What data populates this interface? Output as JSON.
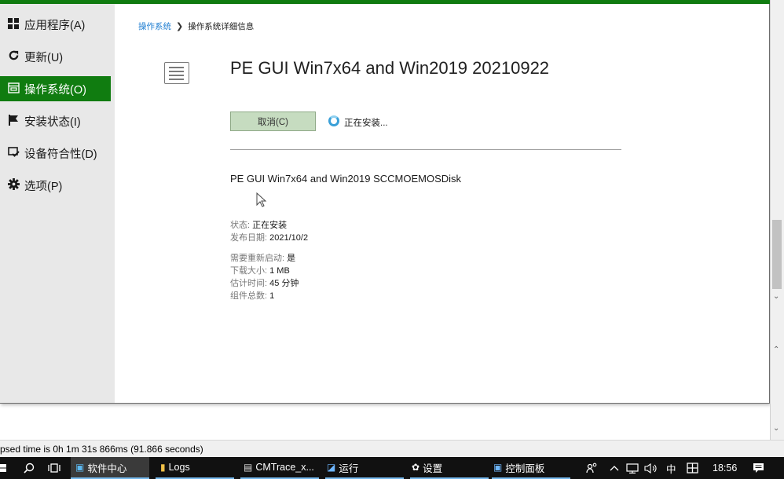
{
  "sidebar": {
    "items": [
      {
        "icon": "apps-grid-icon",
        "glyph": "▦",
        "label": "应用程序(A)"
      },
      {
        "icon": "refresh-icon",
        "glyph": "↻",
        "label": "更新(U)"
      },
      {
        "icon": "os-window-icon",
        "glyph": "⧉",
        "label": "操作系统(O)"
      },
      {
        "icon": "flag-icon",
        "glyph": "⚑",
        "label": "安装状态(I)"
      },
      {
        "icon": "device-compliance-icon",
        "glyph": "⊡",
        "label": "设备符合性(D)"
      },
      {
        "icon": "gear-icon",
        "glyph": "✿",
        "label": "选项(P)"
      }
    ]
  },
  "breadcrumb": {
    "parent": "操作系统",
    "separator": "❯",
    "current": "操作系统详细信息"
  },
  "os": {
    "title": "PE GUI Win7x64 and Win2019 20210922",
    "cancel_label": "取消(C)",
    "progress_text": "正在安装...",
    "package_name": "PE GUI Win7x64 and Win2019 SCCMOEMOSDisk",
    "status_label": "状态: ",
    "status_value": "正在安装",
    "release_label": "发布日期: ",
    "release_value": "2021/10/2",
    "restart_label": "需要重新启动: ",
    "restart_value": "是",
    "size_label": "下载大小: ",
    "size_value": "1 MB",
    "time_label": "估计时间: ",
    "time_value": "45 分钟",
    "count_label": "组件总数: ",
    "count_value": "1"
  },
  "statusline": {
    "text": "psed time is 0h 1m 31s 866ms (91.866 seconds)"
  },
  "taskbar": {
    "items": [
      {
        "icon": "software-center-icon",
        "label": "软件中心"
      },
      {
        "icon": "folder-icon",
        "label": "Logs"
      },
      {
        "icon": "cmtrace-icon",
        "label": "CMTrace_x..."
      },
      {
        "icon": "run-icon",
        "label": "运行"
      },
      {
        "icon": "settings-icon",
        "label": "设置"
      },
      {
        "icon": "control-panel-icon",
        "label": "控制面板"
      }
    ],
    "ime": "中",
    "time": "18:56"
  },
  "colors": {
    "accent": "#107c10",
    "link": "#1e7dd1",
    "taskbar": "#111111"
  }
}
